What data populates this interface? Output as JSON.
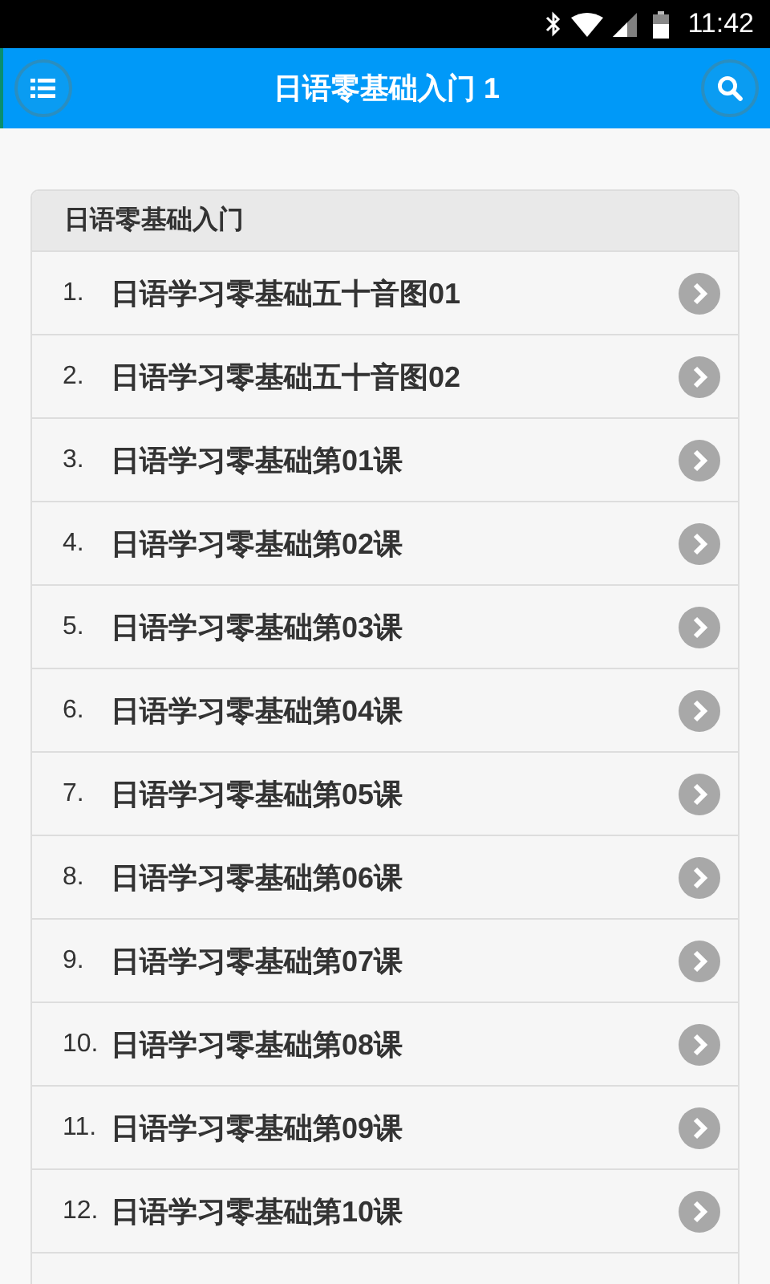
{
  "status_bar": {
    "time": "11:42"
  },
  "header": {
    "title": "日语零基础入门 1"
  },
  "list": {
    "heading": "日语零基础入门",
    "items": [
      {
        "number": "1.",
        "title": "日语学习零基础五十音图01"
      },
      {
        "number": "2.",
        "title": "日语学习零基础五十音图02"
      },
      {
        "number": "3.",
        "title": "日语学习零基础第01课"
      },
      {
        "number": "4.",
        "title": "日语学习零基础第02课"
      },
      {
        "number": "5.",
        "title": "日语学习零基础第03课"
      },
      {
        "number": "6.",
        "title": "日语学习零基础第04课"
      },
      {
        "number": "7.",
        "title": "日语学习零基础第05课"
      },
      {
        "number": "8.",
        "title": "日语学习零基础第06课"
      },
      {
        "number": "9.",
        "title": "日语学习零基础第07课"
      },
      {
        "number": "10.",
        "title": "日语学习零基础第08课"
      },
      {
        "number": "11.",
        "title": "日语学习零基础第09课"
      },
      {
        "number": "12.",
        "title": "日语学习零基础第10课"
      }
    ]
  }
}
